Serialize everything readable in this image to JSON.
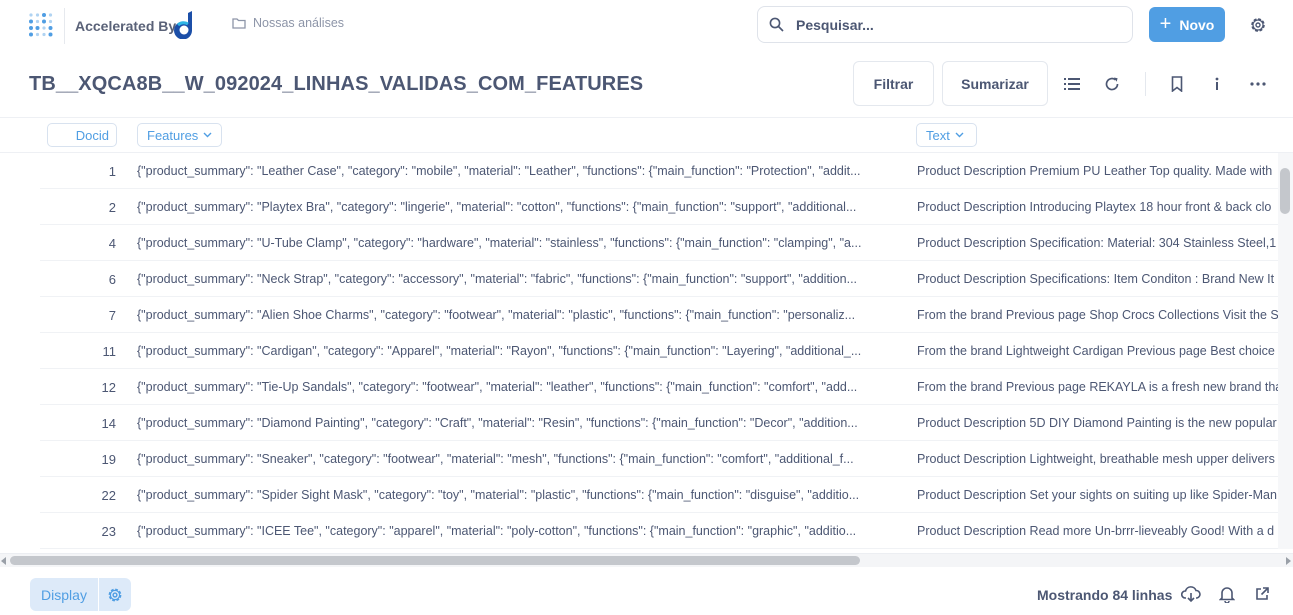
{
  "header": {
    "brand_text": "Accelerated By",
    "breadcrumb": "Nossas análises",
    "search_placeholder": "Pesquisar...",
    "new_button": "Novo"
  },
  "question": {
    "title": "TB__XQCA8B__W_092024_LINHAS_VALIDAS_COM_FEATURES",
    "filter_button": "Filtrar",
    "summarize_button": "Sumarizar"
  },
  "table": {
    "columns": [
      "Docid",
      "Features",
      "Text"
    ],
    "rows": [
      {
        "docid": "1",
        "features": "{\"product_summary\": \"Leather Case\", \"category\": \"mobile\", \"material\": \"Leather\", \"functions\": {\"main_function\": \"Protection\", \"addit...",
        "text": "Product Description Premium PU Leather Top quality. Made with"
      },
      {
        "docid": "2",
        "features": "{\"product_summary\": \"Playtex Bra\", \"category\": \"lingerie\", \"material\": \"cotton\", \"functions\": {\"main_function\": \"support\", \"additional...",
        "text": "Product Description Introducing Playtex 18 hour front & back clo"
      },
      {
        "docid": "4",
        "features": "{\"product_summary\": \"U-Tube Clamp\", \"category\": \"hardware\", \"material\": \"stainless\", \"functions\": {\"main_function\": \"clamping\", \"a...",
        "text": "Product Description Specification: Material: 304 Stainless Steel,1"
      },
      {
        "docid": "6",
        "features": "{\"product_summary\": \"Neck Strap\", \"category\": \"accessory\", \"material\": \"fabric\", \"functions\": {\"main_function\": \"support\", \"addition...",
        "text": "Product Description Specifications: Item Conditon : Brand New It"
      },
      {
        "docid": "7",
        "features": "{\"product_summary\": \"Alien Shoe Charms\", \"category\": \"footwear\", \"material\": \"plastic\", \"functions\": {\"main_function\": \"personaliz...",
        "text": "From the brand Previous page Shop Crocs Collections Visit the Sto"
      },
      {
        "docid": "11",
        "features": "{\"product_summary\": \"Cardigan\", \"category\": \"Apparel\", \"material\": \"Rayon\", \"functions\": {\"main_function\": \"Layering\", \"additional_...",
        "text": "From the brand Lightweight Cardigan Previous page Best choice B"
      },
      {
        "docid": "12",
        "features": "{\"product_summary\": \"Tie-Up Sandals\", \"category\": \"footwear\", \"material\": \"leather\", \"functions\": {\"main_function\": \"comfort\", \"add...",
        "text": "From the brand Previous page REKAYLA is a fresh new brand that"
      },
      {
        "docid": "14",
        "features": "{\"product_summary\": \"Diamond Painting\", \"category\": \"Craft\", \"material\": \"Resin\", \"functions\": {\"main_function\": \"Decor\", \"addition...",
        "text": "Product Description 5D DIY Diamond Painting is the new popular"
      },
      {
        "docid": "19",
        "features": "{\"product_summary\": \"Sneaker\", \"category\": \"footwear\", \"material\": \"mesh\", \"functions\": {\"main_function\": \"comfort\", \"additional_f...",
        "text": "Product Description Lightweight, breathable mesh upper delivers"
      },
      {
        "docid": "22",
        "features": "{\"product_summary\": \"Spider Sight Mask\", \"category\": \"toy\", \"material\": \"plastic\", \"functions\": {\"main_function\": \"disguise\", \"additio...",
        "text": "Product Description Set your sights on suiting up like Spider-Man"
      },
      {
        "docid": "23",
        "features": "{\"product_summary\": \"ICEE Tee\", \"category\": \"apparel\", \"material\": \"poly-cotton\", \"functions\": {\"main_function\": \"graphic\", \"additio...",
        "text": "Product Description Read more Un-brrr-lieveably Good! With a d"
      }
    ]
  },
  "footer": {
    "display_button": "Display",
    "row_count": "Mostrando 84 linhas"
  },
  "colors": {
    "brand_blue": "#509ee3",
    "text": "#4c5773",
    "muted": "#8d95a8"
  },
  "icons": [
    "grid-logo-icon",
    "brand-d-icon",
    "folder-icon",
    "search-icon",
    "plus-icon",
    "gear-icon",
    "list-icon",
    "refresh-icon",
    "bookmark-icon",
    "info-icon",
    "more-icon",
    "chevron-down-icon",
    "download-icon",
    "bell-icon",
    "share-icon"
  ]
}
